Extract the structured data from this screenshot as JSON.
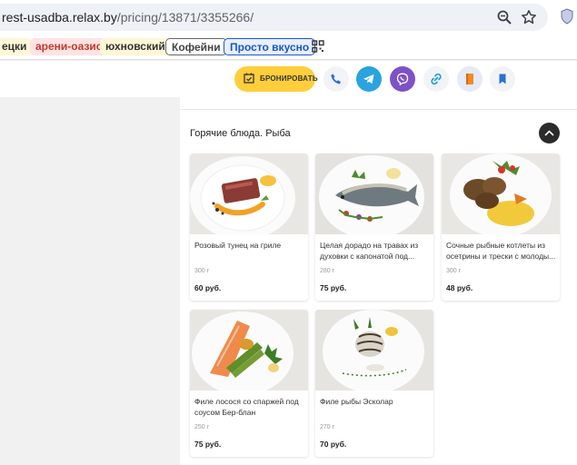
{
  "browser": {
    "url_host": "rest-usadba.relax.by",
    "url_path": "/pricing/13871/3355266/"
  },
  "bookmarks": [
    "ецки",
    "арени-оазис",
    "юхновский",
    "Кофейни",
    "Просто вкусно"
  ],
  "header": {
    "book_label": "БРОНИРОВАТЬ",
    "icons": [
      "phone-icon",
      "telegram-icon",
      "viber-icon",
      "link-icon",
      "menu-book-icon",
      "bookmark-icon"
    ],
    "colors": {
      "book": "#ffce3a",
      "telegram": "#2aa3df",
      "viber": "#7d52c7",
      "icon_bg": "#f1f3f7"
    }
  },
  "section": {
    "title": "Горячие блюда. Рыба"
  },
  "dishes": [
    {
      "name": "Розовый тунец на гриле",
      "weight": "300 г",
      "price": "60 руб."
    },
    {
      "name": "Целая дорадо на травах из духовки с капонатой под...",
      "weight": "280 г",
      "price": "75 руб."
    },
    {
      "name": "Сочные рыбные котлеты из осетрины и трески с молоды...",
      "weight": "300 г",
      "price": "48 руб."
    },
    {
      "name": "Филе лосося со спаржей под соусом Бер-блан",
      "weight": "250 г",
      "price": "75 руб."
    },
    {
      "name": "Филе рыбы Эсколар",
      "weight": "270 г",
      "price": "70 руб."
    }
  ]
}
